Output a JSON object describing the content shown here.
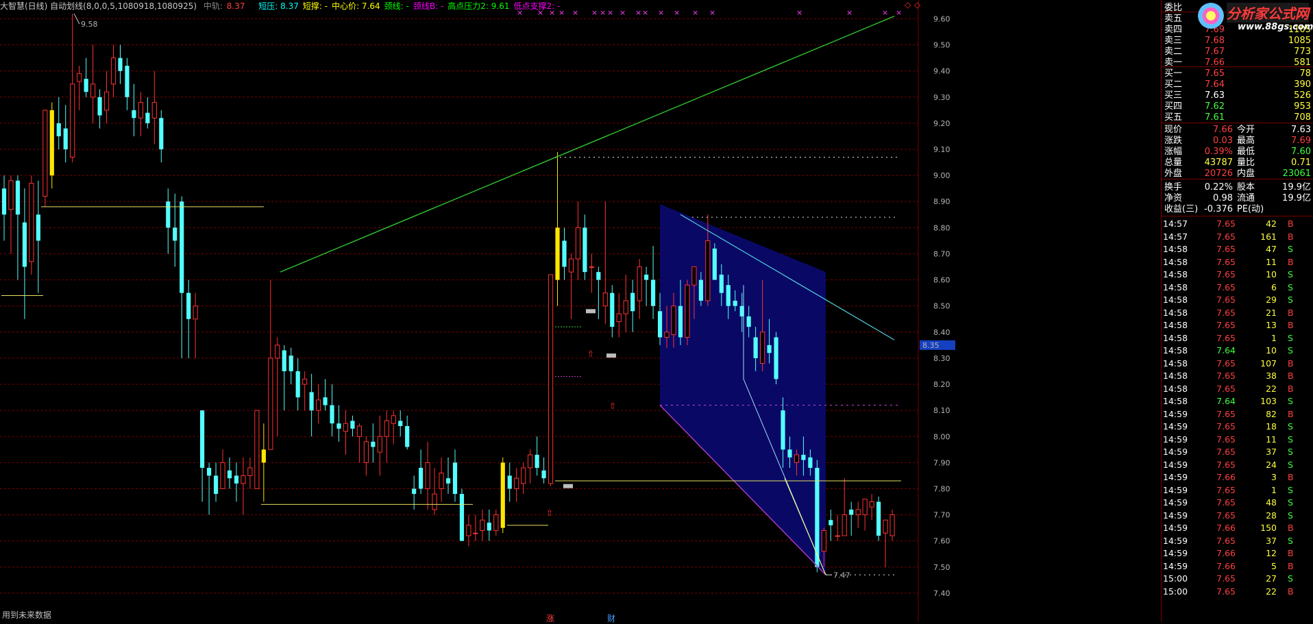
{
  "header": {
    "title": "大智慧(日线) 自动划线(8,0,0,5,1080918,1080925)",
    "zhongshu_label": "中轨:",
    "zhongshu_value": "8.37",
    "items": [
      {
        "label": "短压: 8.37",
        "color": "#00ffff"
      },
      {
        "label": "短撑: -",
        "color": "#ffff00"
      },
      {
        "label": "中心价: 7.64",
        "color": "#ffff00"
      },
      {
        "label": "颈线: -",
        "color": "#00ff00"
      },
      {
        "label": "颈线B: -",
        "color": "#ff00ff"
      },
      {
        "label": "高点压力2: 9.61",
        "color": "#00ff00"
      },
      {
        "label": "低点支撑2: -",
        "color": "#ff00ff"
      }
    ],
    "topright_icons": [
      "diamond-icon",
      "close-icon"
    ]
  },
  "chart_data": {
    "type": "candlestick",
    "ylim": [
      7.35,
      9.63
    ],
    "yticks": [
      "9.60",
      "9.50",
      "9.40",
      "9.30",
      "9.20",
      "9.10",
      "9.00",
      "8.90",
      "8.80",
      "8.70",
      "8.60",
      "8.50",
      "8.40",
      "8.30",
      "8.20",
      "8.10",
      "8.00",
      "7.90",
      "7.80",
      "7.70",
      "7.60",
      "7.50",
      "7.40"
    ],
    "current_price_tag": "8.35",
    "annotations": [
      {
        "text": "9.58",
        "price": 9.58
      },
      {
        "text": "7.47",
        "price": 7.47
      }
    ],
    "colors": {
      "up": "#ff3232",
      "down": "#54ffff",
      "bigup": "#ffe600",
      "bg": "#000000",
      "grid": "#7a0000"
    },
    "candles": [
      [
        8.95,
        9.0,
        8.75,
        8.85
      ],
      [
        8.87,
        9.0,
        8.7,
        8.98
      ],
      [
        8.98,
        9.0,
        8.6,
        8.85
      ],
      [
        8.82,
        8.95,
        8.45,
        8.65
      ],
      [
        8.67,
        9.0,
        8.62,
        8.97
      ],
      [
        8.85,
        8.98,
        8.55,
        8.75
      ],
      [
        8.92,
        9.15,
        8.88,
        9.25
      ],
      [
        9.0,
        9.28,
        8.95,
        9.25
      ],
      [
        9.2,
        9.3,
        9.1,
        9.15
      ],
      [
        9.18,
        9.27,
        9.05,
        9.1
      ],
      [
        9.07,
        9.62,
        9.05,
        9.35
      ],
      [
        9.36,
        9.42,
        9.25,
        9.39
      ],
      [
        9.37,
        9.45,
        9.3,
        9.32
      ],
      [
        9.3,
        9.5,
        9.2,
        9.35
      ],
      [
        9.3,
        9.33,
        9.18,
        9.23
      ],
      [
        9.25,
        9.4,
        9.2,
        9.32
      ],
      [
        9.35,
        9.5,
        9.3,
        9.45
      ],
      [
        9.45,
        9.5,
        9.35,
        9.4
      ],
      [
        9.42,
        9.45,
        9.25,
        9.3
      ],
      [
        9.25,
        9.35,
        9.15,
        9.22
      ],
      [
        9.22,
        9.32,
        9.15,
        9.28
      ],
      [
        9.24,
        9.3,
        9.18,
        9.2
      ],
      [
        9.22,
        9.4,
        9.12,
        9.28
      ],
      [
        9.22,
        9.25,
        9.05,
        9.1
      ],
      [
        8.9,
        8.95,
        8.7,
        8.8
      ],
      [
        8.8,
        8.93,
        8.65,
        8.75
      ],
      [
        8.9,
        8.92,
        8.3,
        8.55
      ],
      [
        8.55,
        8.6,
        8.3,
        8.45
      ],
      [
        8.45,
        8.55,
        8.3,
        8.5
      ],
      [
        8.1,
        8.1,
        7.75,
        7.88
      ],
      [
        7.88,
        7.9,
        7.7,
        7.85
      ],
      [
        7.85,
        7.9,
        7.75,
        7.78
      ],
      [
        7.8,
        7.95,
        7.85,
        7.9
      ],
      [
        7.87,
        7.92,
        7.8,
        7.84
      ],
      [
        7.85,
        7.9,
        7.75,
        7.82
      ],
      [
        7.82,
        7.92,
        7.7,
        7.85
      ],
      [
        7.85,
        7.92,
        7.8,
        7.88
      ],
      [
        7.8,
        8.1,
        7.8,
        8.1
      ],
      [
        7.9,
        8.05,
        7.75,
        7.95
      ],
      [
        7.95,
        8.6,
        7.95,
        8.3
      ],
      [
        8.3,
        8.38,
        8.0,
        8.35
      ],
      [
        8.33,
        8.35,
        8.1,
        8.25
      ],
      [
        8.31,
        8.34,
        8.2,
        8.25
      ],
      [
        8.25,
        8.3,
        8.1,
        8.15
      ],
      [
        8.2,
        8.25,
        8.1,
        8.22
      ],
      [
        8.17,
        8.24,
        8.0,
        8.1
      ],
      [
        8.1,
        8.2,
        8.05,
        8.14
      ],
      [
        8.15,
        8.22,
        8.1,
        8.12
      ],
      [
        8.12,
        8.2,
        8.0,
        8.05
      ],
      [
        8.05,
        8.12,
        7.98,
        8.03
      ],
      [
        8.02,
        8.1,
        7.93,
        8.05
      ],
      [
        8.06,
        8.08,
        8.0,
        8.03
      ],
      [
        8.0,
        8.05,
        7.9,
        8.04
      ],
      [
        7.9,
        8.0,
        7.85,
        7.98
      ],
      [
        7.98,
        8.05,
        7.9,
        7.96
      ],
      [
        7.94,
        8.08,
        7.85,
        8.0
      ],
      [
        8.0,
        8.1,
        7.9,
        8.06
      ],
      [
        8.05,
        8.1,
        7.97,
        8.08
      ],
      [
        8.06,
        8.1,
        8.0,
        8.04
      ],
      [
        8.04,
        8.08,
        7.95,
        7.96
      ],
      [
        7.8,
        7.85,
        7.72,
        7.78
      ],
      [
        7.88,
        7.95,
        7.78,
        7.8
      ],
      [
        7.8,
        7.98,
        7.72,
        7.9
      ],
      [
        7.72,
        7.88,
        7.7,
        7.78
      ],
      [
        7.8,
        7.92,
        7.75,
        7.86
      ],
      [
        7.84,
        7.92,
        7.78,
        7.82
      ],
      [
        7.9,
        7.95,
        7.75,
        7.78
      ],
      [
        7.78,
        7.8,
        7.6,
        7.6
      ],
      [
        7.62,
        7.7,
        7.58,
        7.66
      ],
      [
        7.63,
        7.7,
        7.6,
        7.63
      ],
      [
        7.64,
        7.72,
        7.6,
        7.68
      ],
      [
        7.67,
        7.72,
        7.6,
        7.64
      ],
      [
        7.64,
        7.72,
        7.62,
        7.7
      ],
      [
        7.65,
        7.92,
        7.63,
        7.9
      ],
      [
        7.85,
        7.9,
        7.75,
        7.8
      ],
      [
        7.8,
        7.88,
        7.75,
        7.84
      ],
      [
        7.82,
        7.9,
        7.78,
        7.88
      ],
      [
        7.88,
        7.95,
        7.82,
        7.93
      ],
      [
        7.93,
        8.0,
        7.85,
        7.88
      ],
      [
        7.87,
        7.92,
        7.82,
        7.84
      ],
      [
        7.82,
        8.62,
        7.81,
        8.62
      ],
      [
        8.6,
        9.09,
        8.5,
        8.8
      ],
      [
        8.75,
        8.8,
        8.6,
        8.65
      ],
      [
        8.63,
        8.7,
        8.45,
        8.68
      ],
      [
        8.68,
        8.9,
        8.6,
        8.8
      ],
      [
        8.8,
        8.85,
        8.6,
        8.63
      ],
      [
        8.65,
        8.7,
        8.55,
        8.65
      ],
      [
        8.63,
        8.65,
        8.45,
        8.6
      ],
      [
        8.5,
        8.9,
        8.43,
        8.55
      ],
      [
        8.55,
        8.58,
        8.38,
        8.42
      ],
      [
        8.44,
        8.55,
        8.38,
        8.47
      ],
      [
        8.47,
        8.62,
        8.4,
        8.52
      ],
      [
        8.55,
        8.6,
        8.4,
        8.48
      ],
      [
        8.52,
        8.68,
        8.45,
        8.65
      ],
      [
        8.62,
        8.65,
        8.5,
        8.6
      ],
      [
        8.6,
        8.73,
        8.45,
        8.5
      ],
      [
        8.48,
        8.55,
        8.35,
        8.38
      ],
      [
        8.38,
        8.5,
        8.34,
        8.4
      ],
      [
        8.39,
        8.55,
        8.34,
        8.5
      ],
      [
        8.5,
        8.6,
        8.35,
        8.38
      ],
      [
        8.38,
        8.6,
        8.35,
        8.58
      ],
      [
        8.58,
        8.63,
        8.45,
        8.65
      ],
      [
        8.6,
        8.63,
        8.5,
        8.52
      ],
      [
        8.52,
        8.85,
        8.5,
        8.75
      ],
      [
        8.72,
        8.74,
        8.6,
        8.6
      ],
      [
        8.62,
        8.66,
        8.5,
        8.55
      ],
      [
        8.58,
        8.62,
        8.45,
        8.5
      ],
      [
        8.52,
        8.56,
        8.48,
        8.5
      ],
      [
        8.5,
        8.55,
        8.4,
        8.46
      ],
      [
        8.46,
        8.5,
        8.38,
        8.42
      ],
      [
        8.38,
        8.42,
        8.25,
        8.3
      ],
      [
        8.28,
        8.6,
        8.25,
        8.4
      ],
      [
        8.35,
        8.45,
        8.28,
        8.32
      ],
      [
        8.38,
        8.4,
        8.2,
        8.22
      ],
      [
        8.1,
        8.15,
        7.88,
        7.95
      ],
      [
        7.95,
        8.0,
        7.88,
        7.92
      ],
      [
        7.9,
        7.95,
        7.85,
        7.93
      ],
      [
        7.93,
        8.0,
        7.85,
        7.91
      ],
      [
        7.92,
        7.95,
        7.85,
        7.88
      ],
      [
        7.88,
        7.91,
        7.48,
        7.5
      ],
      [
        7.56,
        7.65,
        7.5,
        7.64
      ],
      [
        7.68,
        7.72,
        7.6,
        7.66
      ],
      [
        7.62,
        7.7,
        7.6,
        7.62
      ],
      [
        7.62,
        7.84,
        7.62,
        7.7
      ],
      [
        7.72,
        7.75,
        7.62,
        7.7
      ],
      [
        7.7,
        7.75,
        7.65,
        7.72
      ],
      [
        7.7,
        7.76,
        7.64,
        7.76
      ],
      [
        7.73,
        7.78,
        7.68,
        7.75
      ],
      [
        7.75,
        7.77,
        7.6,
        7.62
      ],
      [
        7.63,
        7.65,
        7.5,
        7.68
      ],
      [
        7.62,
        7.72,
        7.6,
        7.7
      ]
    ],
    "bigyellow": [
      7,
      38,
      73,
      81
    ],
    "xmarks": [
      "×",
      "×",
      "×",
      "×",
      "×",
      "×",
      "×",
      "×",
      "×",
      "×",
      "×",
      "×",
      "×",
      "×",
      "×",
      "×",
      "×",
      "×",
      "×"
    ]
  },
  "quote": {
    "rows": [
      {
        "label": "委比",
        "price": "",
        "vol": ""
      },
      {
        "label": "卖五",
        "price": "",
        "vol": ""
      },
      {
        "label": "卖四",
        "price": "7.69",
        "vol": "1105",
        "pc": "#ff4040"
      },
      {
        "label": "卖三",
        "price": "7.68",
        "vol": "1085",
        "pc": "#ff4040"
      },
      {
        "label": "卖二",
        "price": "7.67",
        "vol": "773",
        "pc": "#ff4040"
      },
      {
        "label": "卖一",
        "price": "7.66",
        "vol": "581",
        "pc": "#ff4040"
      },
      {
        "label": "买一",
        "price": "7.65",
        "vol": "78",
        "pc": "#ff4040"
      },
      {
        "label": "买二",
        "price": "7.64",
        "vol": "390",
        "pc": "#ff4040"
      },
      {
        "label": "买三",
        "price": "7.63",
        "vol": "526",
        "pc": "#ffffff"
      },
      {
        "label": "买四",
        "price": "7.62",
        "vol": "953",
        "pc": "#40ff40"
      },
      {
        "label": "买五",
        "price": "7.61",
        "vol": "708",
        "pc": "#40ff40"
      }
    ],
    "stats": [
      {
        "l1": "现价",
        "v1": "7.66",
        "c1": "#ff4040",
        "l2": "今开",
        "v2": "7.63",
        "c2": "#ffffff"
      },
      {
        "l1": "涨跌",
        "v1": "0.03",
        "c1": "#ff4040",
        "l2": "最高",
        "v2": "7.69",
        "c2": "#ff4040"
      },
      {
        "l1": "涨幅",
        "v1": "0.39%",
        "c1": "#ff4040",
        "l2": "最低",
        "v2": "7.60",
        "c2": "#40ff40"
      },
      {
        "l1": "总量",
        "v1": "43787",
        "c1": "#ffff40",
        "l2": "量比",
        "v2": "0.71",
        "c2": "#ffff40"
      },
      {
        "l1": "外盘",
        "v1": "20726",
        "c1": "#ff4040",
        "l2": "内盘",
        "v2": "23061",
        "c2": "#40ff40"
      }
    ],
    "stats2": [
      {
        "l1": "换手",
        "v1": "0.22%",
        "c1": "#ffffff",
        "l2": "股本",
        "v2": "19.9亿",
        "c2": "#ffffff"
      },
      {
        "l1": "净资",
        "v1": "0.98",
        "c1": "#ffffff",
        "l2": "流通",
        "v2": "19.9亿",
        "c2": "#ffffff"
      },
      {
        "l1": "收益(三)",
        "v1": "-0.376",
        "c1": "#ffffff",
        "l2": "PE(动)",
        "v2": "",
        "c2": "#ffffff"
      }
    ],
    "ticks": [
      [
        "14:57",
        "7.65",
        "42",
        "B"
      ],
      [
        "14:57",
        "7.65",
        "161",
        "B"
      ],
      [
        "14:58",
        "7.65",
        "47",
        "S"
      ],
      [
        "14:58",
        "7.65",
        "11",
        "B"
      ],
      [
        "14:58",
        "7.65",
        "10",
        "S"
      ],
      [
        "14:58",
        "7.65",
        "6",
        "S"
      ],
      [
        "14:58",
        "7.65",
        "29",
        "S"
      ],
      [
        "14:58",
        "7.65",
        "21",
        "B"
      ],
      [
        "14:58",
        "7.65",
        "13",
        "B"
      ],
      [
        "14:58",
        "7.65",
        "1",
        "S"
      ],
      [
        "14:58",
        "7.64",
        "10",
        "S"
      ],
      [
        "14:58",
        "7.65",
        "107",
        "B"
      ],
      [
        "14:58",
        "7.65",
        "38",
        "B"
      ],
      [
        "14:58",
        "7.65",
        "22",
        "B"
      ],
      [
        "14:58",
        "7.64",
        "103",
        "S"
      ],
      [
        "14:59",
        "7.65",
        "82",
        "B"
      ],
      [
        "14:59",
        "7.65",
        "18",
        "S"
      ],
      [
        "14:59",
        "7.65",
        "11",
        "S"
      ],
      [
        "14:59",
        "7.65",
        "37",
        "S"
      ],
      [
        "14:59",
        "7.65",
        "24",
        "S"
      ],
      [
        "14:59",
        "7.66",
        "3",
        "B"
      ],
      [
        "14:59",
        "7.65",
        "1",
        "S"
      ],
      [
        "14:59",
        "7.65",
        "48",
        "S"
      ],
      [
        "14:59",
        "7.65",
        "28",
        "S"
      ],
      [
        "14:59",
        "7.66",
        "150",
        "B"
      ],
      [
        "14:59",
        "7.65",
        "37",
        "S"
      ],
      [
        "14:59",
        "7.66",
        "12",
        "B"
      ],
      [
        "14:59",
        "7.66",
        "5",
        "B"
      ],
      [
        "15:00",
        "7.65",
        "27",
        "S"
      ],
      [
        "15:00",
        "7.65",
        "22",
        "B"
      ]
    ]
  },
  "logo": {
    "text": "分析家公式网",
    "url": "www.88gs.com"
  },
  "footer": {
    "note": "用到未来数据",
    "mark1": "涨",
    "mark2": "财"
  }
}
